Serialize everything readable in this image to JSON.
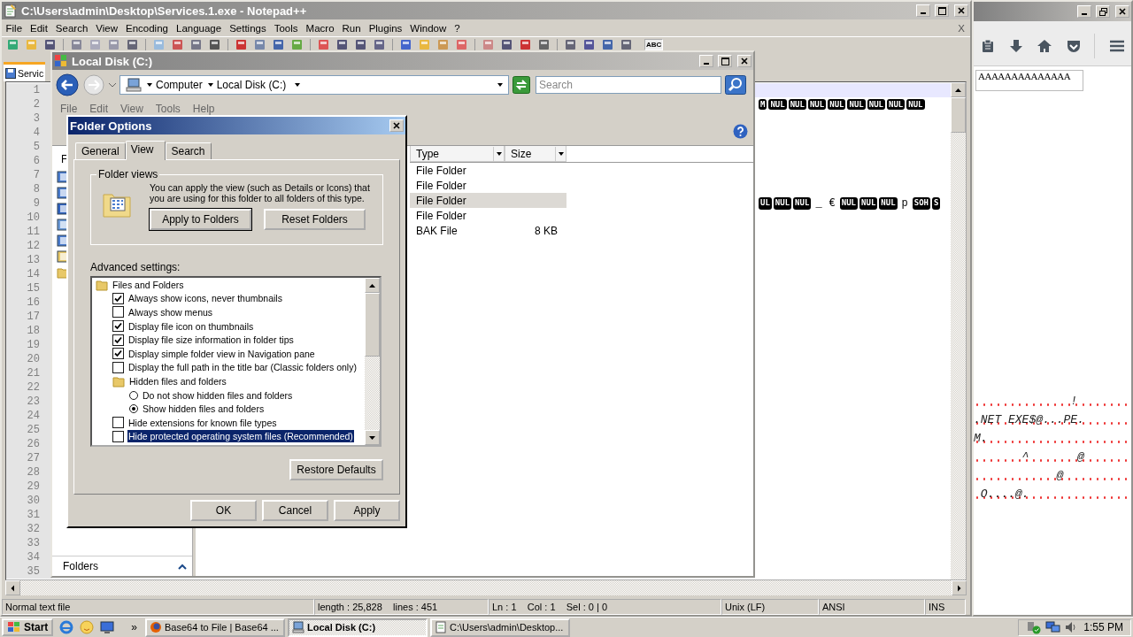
{
  "notepad": {
    "title": "C:\\Users\\admin\\Desktop\\Services.1.exe - Notepad++",
    "menu": [
      "File",
      "Edit",
      "Search",
      "View",
      "Encoding",
      "Language",
      "Settings",
      "Tools",
      "Macro",
      "Run",
      "Plugins",
      "Window",
      "?"
    ],
    "close_mark": "X",
    "spell_button": "ABC",
    "tab": {
      "label": "Servic",
      "selected": true
    },
    "lines": [
      {
        "number": "1",
        "current": true
      },
      {
        "number": "2",
        "current": false,
        "tokens": [
          {
            "kind": "ctrl",
            "text": "M"
          },
          {
            "kind": "ctrl",
            "text": "NUL"
          },
          {
            "kind": "ctrl",
            "text": "NUL"
          },
          {
            "kind": "ctrl",
            "text": "NUL"
          },
          {
            "kind": "ctrl",
            "text": "NUL"
          },
          {
            "kind": "ctrl",
            "text": "NUL"
          },
          {
            "kind": "ctrl",
            "text": "NUL"
          },
          {
            "kind": "ctrl",
            "text": "NUL"
          },
          {
            "kind": "ctrl",
            "text": "NUL"
          }
        ]
      },
      {
        "number": "3",
        "current": false
      },
      {
        "number": "4",
        "current": false
      },
      {
        "number": "5",
        "current": false
      },
      {
        "number": "6",
        "current": false
      },
      {
        "number": "7",
        "current": false
      },
      {
        "number": "8",
        "current": false
      },
      {
        "number": "9",
        "current": false,
        "tokens": [
          {
            "kind": "ctrl",
            "text": "UL"
          },
          {
            "kind": "ctrl",
            "text": "NUL"
          },
          {
            "kind": "ctrl",
            "text": "NUL"
          },
          {
            "kind": "text",
            "text": "_"
          },
          {
            "kind": "text",
            "text": "€"
          },
          {
            "kind": "ctrl",
            "text": "NUL"
          },
          {
            "kind": "ctrl",
            "text": "NUL"
          },
          {
            "kind": "ctrl",
            "text": "NUL"
          },
          {
            "kind": "text",
            "text": "p"
          },
          {
            "kind": "ctrl",
            "text": "SOH"
          },
          {
            "kind": "ctrl",
            "text": "S"
          }
        ]
      },
      {
        "number": "10",
        "current": false
      },
      {
        "number": "11",
        "current": false
      },
      {
        "number": "12",
        "current": false
      },
      {
        "number": "13",
        "current": false
      },
      {
        "number": "14",
        "current": false
      },
      {
        "number": "15",
        "current": false
      },
      {
        "number": "16",
        "current": false
      },
      {
        "number": "17",
        "current": false
      },
      {
        "number": "18",
        "current": false
      },
      {
        "number": "19",
        "current": false
      },
      {
        "number": "20",
        "current": false
      },
      {
        "number": "21",
        "current": false
      },
      {
        "number": "22",
        "current": false
      },
      {
        "number": "23",
        "current": false
      },
      {
        "number": "24",
        "current": false
      },
      {
        "number": "25",
        "current": false
      },
      {
        "number": "26",
        "current": false
      },
      {
        "number": "27",
        "current": false
      },
      {
        "number": "28",
        "current": false
      },
      {
        "number": "29",
        "current": false
      },
      {
        "number": "30",
        "current": false
      },
      {
        "number": "31",
        "current": false
      },
      {
        "number": "32",
        "current": false
      },
      {
        "number": "33",
        "current": false
      },
      {
        "number": "34",
        "current": false
      },
      {
        "number": "35",
        "current": false
      }
    ],
    "status": [
      "Normal text file",
      "length : 25,828    lines : 451",
      "Ln : 1    Col : 1    Sel : 0 | 0",
      "Unix (LF)",
      "ANSI",
      "INS"
    ]
  },
  "explorer": {
    "title": "Local Disk (C:)",
    "breadcrumbs": [
      "Computer",
      "Local Disk (C:)"
    ],
    "search_placeholder": "Search",
    "menu": [
      "File",
      "Edit",
      "View",
      "Tools",
      "Help"
    ],
    "nav_fragment": "F",
    "nav_footer": "Folders",
    "columns": [
      "Type",
      "Size"
    ],
    "rows": [
      {
        "type": "File Folder",
        "selected": false
      },
      {
        "type": "File Folder",
        "selected": false
      },
      {
        "type": "File Folder",
        "selected": true
      },
      {
        "type": "File Folder",
        "selected": false
      },
      {
        "type": "BAK File",
        "size": "8 KB",
        "selected": false
      }
    ]
  },
  "dialog": {
    "title": "Folder Options",
    "tabs": [
      {
        "label": "General",
        "selected": false
      },
      {
        "label": "View",
        "selected": true
      },
      {
        "label": "Search",
        "selected": false
      }
    ],
    "group_title": "Folder views",
    "description": "You can apply the view (such as Details or Icons) that you are using for this folder to all folders of this type.",
    "group_buttons": [
      "Apply to Folders",
      "Reset Folders"
    ],
    "advanced_label": "Advanced settings:",
    "advanced": [
      {
        "kind": "folder",
        "label": "Files and Folders",
        "selected": false,
        "children": [
          {
            "kind": "checkbox",
            "label": "Always show icons, never thumbnails",
            "checked": true,
            "selected": false
          },
          {
            "kind": "checkbox",
            "label": "Always show menus",
            "checked": false,
            "selected": false
          },
          {
            "kind": "checkbox",
            "label": "Display file icon on thumbnails",
            "checked": true,
            "selected": false
          },
          {
            "kind": "checkbox",
            "label": "Display file size information in folder tips",
            "checked": true,
            "selected": false
          },
          {
            "kind": "checkbox",
            "label": "Display simple folder view in Navigation pane",
            "checked": true,
            "selected": false
          },
          {
            "kind": "checkbox",
            "label": "Display the full path in the title bar (Classic folders only)",
            "checked": false,
            "selected": false
          },
          {
            "kind": "folder",
            "label": "Hidden files and folders",
            "selected": false,
            "children": [
              {
                "kind": "radio",
                "label": "Do not show hidden files and folders",
                "checked": false,
                "selected": false
              },
              {
                "kind": "radio",
                "label": "Show hidden files and folders",
                "checked": true,
                "selected": false
              }
            ]
          },
          {
            "kind": "checkbox",
            "label": "Hide extensions for known file types",
            "checked": false,
            "selected": false
          },
          {
            "kind": "checkbox",
            "label": "Hide protected operating system files (Recommended)",
            "checked": false,
            "selected": true
          }
        ]
      }
    ],
    "restore_button": "Restore Defaults",
    "footer_buttons": [
      "OK",
      "Cancel",
      "Apply"
    ]
  },
  "browser": {
    "field_text": "AAAAAAAAAAAAAA",
    "lines": [
      {
        "text": "              !"
      },
      {
        "text": ".NET EXE$@...PE."
      },
      {
        "text": "M."
      },
      {
        "text": "       ^       @"
      },
      {
        "text": "            @"
      },
      {
        "text": " O....@."
      }
    ]
  },
  "taskbar": {
    "start": "Start",
    "overflow": "»",
    "tasks": [
      {
        "label": "Base64 to File | Base64 ...",
        "selected": false
      },
      {
        "label": "Local Disk (C:)",
        "selected": true
      },
      {
        "label": "C:\\Users\\admin\\Desktop...",
        "selected": false
      }
    ],
    "clock": "1:55 PM"
  }
}
